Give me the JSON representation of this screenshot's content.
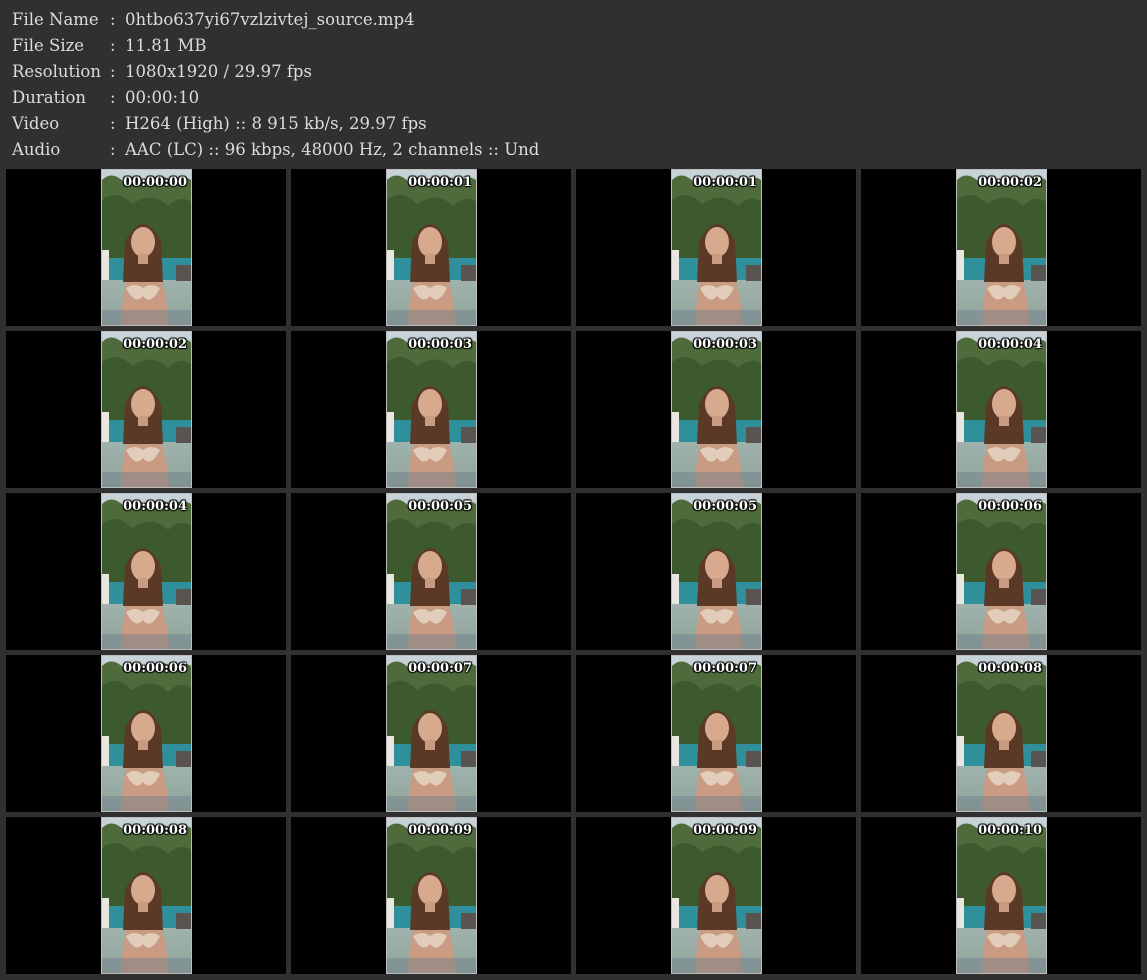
{
  "info": [
    {
      "label": "File Name",
      "sep": ":",
      "value": "0htbo637yi67vzlzivtej_source.mp4"
    },
    {
      "label": "File Size",
      "sep": ":",
      "value": "11.81 MB"
    },
    {
      "label": "Resolution",
      "sep": ":",
      "value": "1080x1920 / 29.97 fps"
    },
    {
      "label": "Duration",
      "sep": ":",
      "value": "00:00:10"
    },
    {
      "label": "Video",
      "sep": ":",
      "value": "H264 (High) :: 8 915 kb/s, 29.97 fps"
    },
    {
      "label": "Audio",
      "sep": ":",
      "value": "AAC (LC) :: 96 kbps, 48000 Hz, 2 channels :: Und"
    }
  ],
  "thumbnails": [
    {
      "timestamp": "00:00:00"
    },
    {
      "timestamp": "00:00:01"
    },
    {
      "timestamp": "00:00:01"
    },
    {
      "timestamp": "00:00:02"
    },
    {
      "timestamp": "00:00:02"
    },
    {
      "timestamp": "00:00:03"
    },
    {
      "timestamp": "00:00:03"
    },
    {
      "timestamp": "00:00:04"
    },
    {
      "timestamp": "00:00:04"
    },
    {
      "timestamp": "00:00:05"
    },
    {
      "timestamp": "00:00:05"
    },
    {
      "timestamp": "00:00:06"
    },
    {
      "timestamp": "00:00:06"
    },
    {
      "timestamp": "00:00:07"
    },
    {
      "timestamp": "00:00:07"
    },
    {
      "timestamp": "00:00:08"
    },
    {
      "timestamp": "00:00:08"
    },
    {
      "timestamp": "00:00:09"
    },
    {
      "timestamp": "00:00:09"
    },
    {
      "timestamp": "00:00:10"
    }
  ],
  "colors": {
    "background": "#303030",
    "text": "#dcdcdc",
    "cell": "#000000",
    "frame_border": "#bdbdbd"
  }
}
